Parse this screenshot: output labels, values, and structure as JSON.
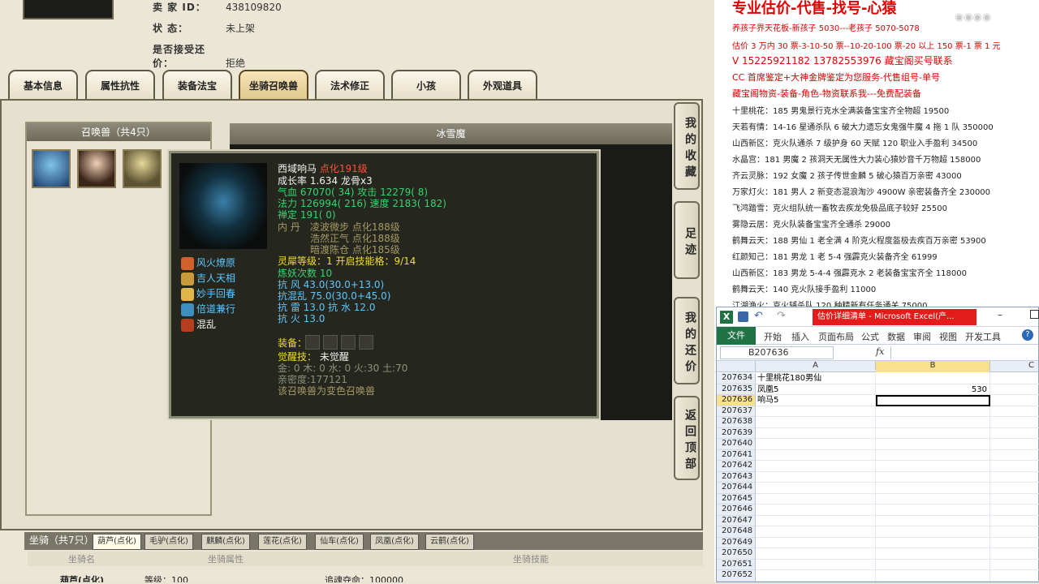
{
  "game": {
    "seller_label": "卖  家  ID：",
    "seller_id": "438109820",
    "status_label": "状        态：",
    "status_value": "未上架",
    "counter_label": "是否接受还价：",
    "counter_value": "拒绝",
    "tabs": [
      "基本信息",
      "属性抗性",
      "装备法宝",
      "坐骑召唤兽",
      "法术修正",
      "小孩",
      "外观道具"
    ],
    "active_tab": "坐骑召唤兽",
    "pet_list_title": "召唤兽（共4只）",
    "selected_pet_name": "冰雪魔",
    "side_buttons": [
      "我的收藏",
      "足迹",
      "我的还价",
      "返回顶部"
    ],
    "tooltip": {
      "name": "西域响马",
      "level": "点化191级",
      "growth": "成长率 1.634 龙骨x3",
      "hp": "气血 67070( 34) 攻击 12279( 8)",
      "mp": "法力 126994( 216) 速度 2183( 182)",
      "ding": "禅定 191( 0)",
      "neidan_label": "内   丹",
      "neidan": [
        "凌波微步 点化188级",
        "浩然正气 点化188级",
        "暗渡陈仓 点化185级"
      ],
      "skills": [
        "风火燎原",
        "吉人天相",
        "妙手回春",
        "倍道兼行",
        "混乱"
      ],
      "lingxi": "灵犀等级：1 开启技能格：9/14",
      "lianyao": "炼妖次数 10",
      "resist_wind": "抗   风 43.0(30.0+13.0)",
      "resist_chaos": "抗混乱 75.0(30.0+45.0)",
      "resist_thunder_water": "抗   雷 13.0 抗   水 12.0",
      "resist_fire": "抗   火 13.0",
      "equip_label": "装备：",
      "awaken_label": "觉醒技：",
      "awaken_value": "未觉醒",
      "elements": "金: 0 木: 0 水: 0 火:30 土:70",
      "intimacy": "亲密度:177121",
      "transform": "该召唤兽为变色召唤兽"
    },
    "mount_label": "坐骑（共7只）",
    "mount_tabs": [
      "葫芦(点化)",
      "毛驴(点化)",
      "麒麟(点化)",
      "莲花(点化)",
      "仙车(点化)",
      "凤凰(点化)",
      "云鹤(点化)"
    ],
    "mount_cols": [
      "坐骑名",
      "坐骑属性",
      "坐骑技能"
    ],
    "mount_row": {
      "name": "葫芦(点化)",
      "attr": "等级：100",
      "skill": "追魂夺命：100000"
    }
  },
  "right": {
    "heading": "专业估价-代售-找号-心猿",
    "red_lines": [
      "养孩子界天花板-新孩子 5030---老孩子 5070-5078",
      "估价 3 万内 30 票-3-10-50 票--10-20-100 票-20 以上 150 票-1 票 1 元",
      "V 15225921182        13782553976    藏宝阁买号联系",
      "CC 首席鉴定+大神金牌鉴定为您服务-代售组号-单号",
      "藏宝阁物资-装备-角色-物资联系我---免费配装备"
    ],
    "listings": [
      "十里桃花：185 男鬼景行克水全满装备宝宝齐全物超 19500",
      "天若有情：14-16 星通杀队 6 破大力遗忘女鬼强牛魔 4 拖 1 队 350000",
      "山西新区：克火队通杀 7 级护身 60 天赋 120 职业入手盈利 34500",
      "水晶宫：181 男魔 2 孩洞天无属性大力装心猿妙音千万物超 158000",
      "齐云灵脉：192 女魔 2 孩子传世金麟 5 破心猿百万亲密 43000",
      "万家灯火：181 男人 2 新变态混浪淘沙 4900W 亲密装备齐全 230000",
      "飞鸿踏雪：克火组队统一畜牧去疾龙免极品底子较好 25500",
      "雾隐云居：克火队装备宝宝齐全通杀 29000",
      "鹤舞云天：188 男仙 1 老全满 4 阶克火程度盔极去疾百万亲密 53900",
      "红颜知己：181 男龙 1 老 5-4 强霹克火装备齐全 61999",
      "山西新区：183 男龙 5-4-4 强霹克水 2 老装备宝宝齐全 118000",
      "鹤舞云天：140 克火队接手盈利 11000",
      "江湖渔火：克火辅杀队 120 种精新有任务通关 75000"
    ]
  },
  "excel": {
    "title": "估价详细清单 - Microsoft Excel(产...",
    "menu": [
      "文件",
      "开始",
      "插入",
      "页面布局",
      "公式",
      "数据",
      "审阅",
      "视图",
      "开发工具"
    ],
    "name_box": "B207636",
    "fx": "fx",
    "col_headers": [
      "A",
      "B",
      "C"
    ],
    "rows": [
      {
        "n": "207634",
        "a": "十里桃花180男仙",
        "b": ""
      },
      {
        "n": "207635",
        "a": "凤凰5",
        "b": "530"
      },
      {
        "n": "207636",
        "a": "响马5",
        "b": ""
      },
      {
        "n": "207637",
        "a": "",
        "b": ""
      },
      {
        "n": "207638",
        "a": "",
        "b": ""
      },
      {
        "n": "207639",
        "a": "",
        "b": ""
      },
      {
        "n": "207640",
        "a": "",
        "b": ""
      },
      {
        "n": "207641",
        "a": "",
        "b": ""
      },
      {
        "n": "207642",
        "a": "",
        "b": ""
      },
      {
        "n": "207643",
        "a": "",
        "b": ""
      },
      {
        "n": "207644",
        "a": "",
        "b": ""
      },
      {
        "n": "207645",
        "a": "",
        "b": ""
      },
      {
        "n": "207646",
        "a": "",
        "b": ""
      },
      {
        "n": "207647",
        "a": "",
        "b": ""
      },
      {
        "n": "207648",
        "a": "",
        "b": ""
      },
      {
        "n": "207649",
        "a": "",
        "b": ""
      },
      {
        "n": "207650",
        "a": "",
        "b": ""
      },
      {
        "n": "207651",
        "a": "",
        "b": ""
      },
      {
        "n": "207652",
        "a": "",
        "b": ""
      }
    ]
  }
}
